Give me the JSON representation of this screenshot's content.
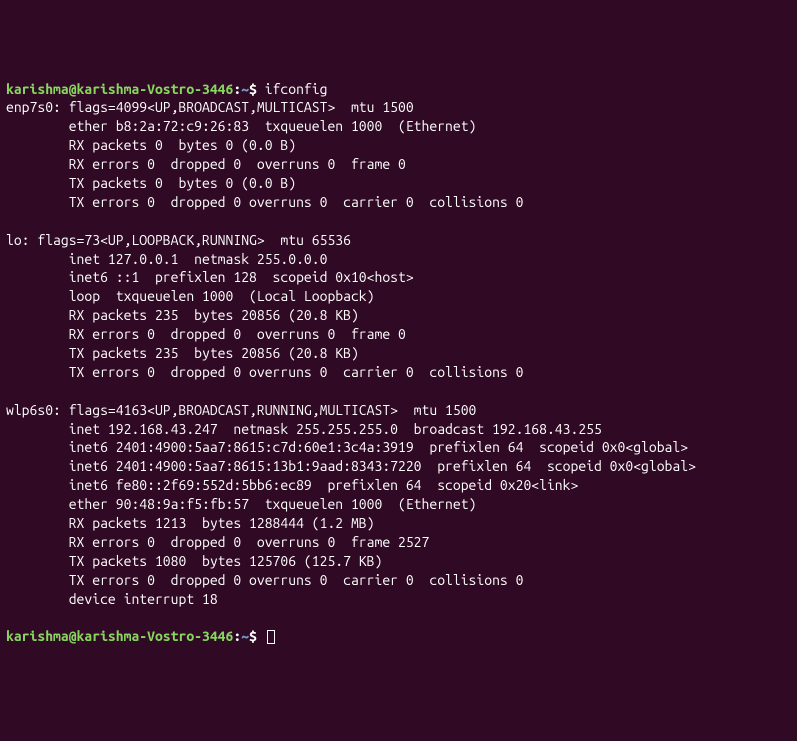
{
  "prompt1": {
    "user_host": "karishma@karishma-Vostro-3446",
    "sep": ":",
    "path": "~",
    "dollar": "$ ",
    "command": "ifconfig"
  },
  "enp7s0": {
    "l1": "enp7s0: flags=4099<UP,BROADCAST,MULTICAST>  mtu 1500",
    "l2": "        ether b8:2a:72:c9:26:83  txqueuelen 1000  (Ethernet)",
    "l3": "        RX packets 0  bytes 0 (0.0 B)",
    "l4": "        RX errors 0  dropped 0  overruns 0  frame 0",
    "l5": "        TX packets 0  bytes 0 (0.0 B)",
    "l6": "        TX errors 0  dropped 0 overruns 0  carrier 0  collisions 0"
  },
  "lo": {
    "l1": "lo: flags=73<UP,LOOPBACK,RUNNING>  mtu 65536",
    "l2": "        inet 127.0.0.1  netmask 255.0.0.0",
    "l3": "        inet6 ::1  prefixlen 128  scopeid 0x10<host>",
    "l4": "        loop  txqueuelen 1000  (Local Loopback)",
    "l5": "        RX packets 235  bytes 20856 (20.8 KB)",
    "l6": "        RX errors 0  dropped 0  overruns 0  frame 0",
    "l7": "        TX packets 235  bytes 20856 (20.8 KB)",
    "l8": "        TX errors 0  dropped 0 overruns 0  carrier 0  collisions 0"
  },
  "wlp6s0": {
    "l1": "wlp6s0: flags=4163<UP,BROADCAST,RUNNING,MULTICAST>  mtu 1500",
    "l2": "        inet 192.168.43.247  netmask 255.255.255.0  broadcast 192.168.43.255",
    "l3": "        inet6 2401:4900:5aa7:8615:c7d:60e1:3c4a:3919  prefixlen 64  scopeid 0x0<global>",
    "l4": "        inet6 2401:4900:5aa7:8615:13b1:9aad:8343:7220  prefixlen 64  scopeid 0x0<global>",
    "l5": "        inet6 fe80::2f69:552d:5bb6:ec89  prefixlen 64  scopeid 0x20<link>",
    "l6": "        ether 90:48:9a:f5:fb:57  txqueuelen 1000  (Ethernet)",
    "l7": "        RX packets 1213  bytes 1288444 (1.2 MB)",
    "l8": "        RX errors 0  dropped 0  overruns 0  frame 2527",
    "l9": "        TX packets 1080  bytes 125706 (125.7 KB)",
    "l10": "        TX errors 0  dropped 0 overruns 0  carrier 0  collisions 0",
    "l11": "        device interrupt 18  "
  },
  "prompt2": {
    "user_host": "karishma@karishma-Vostro-3446",
    "sep": ":",
    "path": "~",
    "dollar": "$ "
  }
}
